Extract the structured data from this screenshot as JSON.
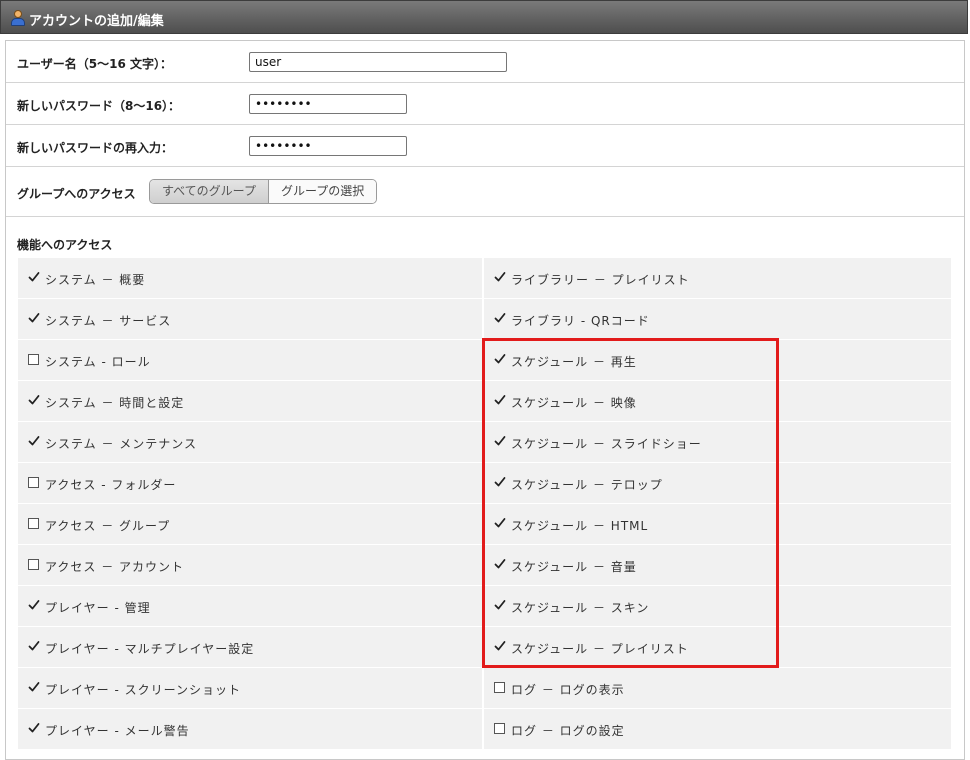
{
  "window": {
    "title": "アカウントの追加/編集"
  },
  "form": {
    "username_label": "ユーザー名（5〜16 文字）：",
    "username_value": "user",
    "password_label": "新しいパスワード（8〜16）：",
    "password_value": "12345678",
    "password_confirm_label": "新しいパスワードの再入力：",
    "password_confirm_value": "12345678",
    "group_access_label": "グループへのアクセス",
    "group_options": [
      "すべてのグループ",
      "グループの選択"
    ],
    "group_selected": "すべてのグループ"
  },
  "feature_access": {
    "label": "機能へのアクセス",
    "left": [
      {
        "label": "システム － 概要",
        "checked": true
      },
      {
        "label": "システム － サービス",
        "checked": true
      },
      {
        "label": "システム - ロール",
        "checked": false
      },
      {
        "label": "システム － 時間と設定",
        "checked": true
      },
      {
        "label": "システム － メンテナンス",
        "checked": true
      },
      {
        "label": "アクセス - フォルダー",
        "checked": false
      },
      {
        "label": "アクセス － グループ",
        "checked": false
      },
      {
        "label": "アクセス － アカウント",
        "checked": false
      },
      {
        "label": "プレイヤー - 管理",
        "checked": true
      },
      {
        "label": "プレイヤー - マルチプレイヤー設定",
        "checked": true
      },
      {
        "label": "プレイヤー - スクリーンショット",
        "checked": true
      },
      {
        "label": "プレイヤー - メール警告",
        "checked": true
      }
    ],
    "right": [
      {
        "label": "ライブラリー － プレイリスト",
        "checked": true
      },
      {
        "label": "ライブラリ - QRコード",
        "checked": true
      },
      {
        "label": "スケジュール － 再生",
        "checked": true
      },
      {
        "label": "スケジュール － 映像",
        "checked": true
      },
      {
        "label": "スケジュール － スライドショー",
        "checked": true
      },
      {
        "label": "スケジュール － テロップ",
        "checked": true
      },
      {
        "label": "スケジュール － HTML",
        "checked": true
      },
      {
        "label": "スケジュール － 音量",
        "checked": true
      },
      {
        "label": "スケジュール － スキン",
        "checked": true
      },
      {
        "label": "スケジュール － プレイリスト",
        "checked": true
      },
      {
        "label": "ログ － ログの表示",
        "checked": false
      },
      {
        "label": "ログ － ログの設定",
        "checked": false
      }
    ]
  },
  "colors": {
    "highlight": "#e21b1b",
    "titlebar": "#5e5e5e",
    "cell_bg": "#f1f1f1"
  }
}
